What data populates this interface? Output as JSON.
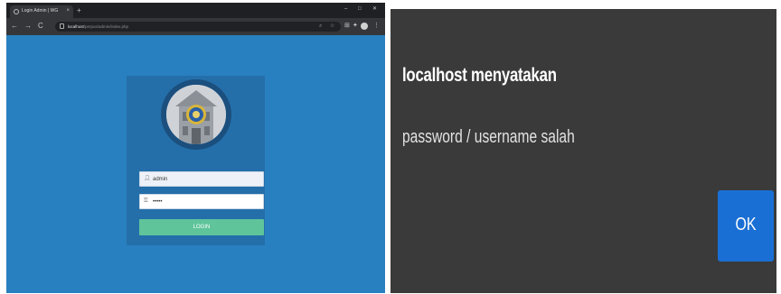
{
  "browser": {
    "tab_title": "Login Admin | WG",
    "tab_close": "×",
    "new_tab": "+",
    "window_controls": [
      "–",
      "□",
      "✕"
    ],
    "nav": {
      "back": "←",
      "forward": "→",
      "reload": "C"
    },
    "url_host": "localhost",
    "url_path": "/perpus/admin/index.php",
    "toolbar_icons": [
      "☆",
      "⊞",
      "✦",
      "⋮"
    ]
  },
  "login": {
    "username_value": "admin",
    "password_mask": "•••••",
    "login_label": "LOGIN",
    "user_icon": "person-icon",
    "key_icon": "key-icon"
  },
  "dialog": {
    "title": "localhost menyatakan",
    "message": "password / username salah",
    "ok_label": "OK"
  },
  "colors": {
    "page_bg": "#2980c0",
    "card_bg": "#246fa9",
    "login_button": "#5fc49a",
    "dialog_bg": "#3a3a3a",
    "ok_button": "#1a6fd4"
  }
}
